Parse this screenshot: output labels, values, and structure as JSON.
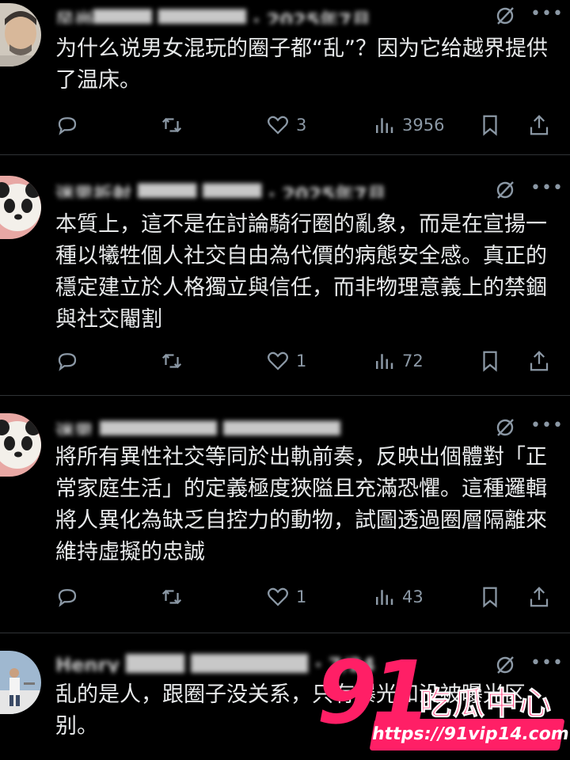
{
  "posts": [
    {
      "author_blurred": "风尚████ ██████ · 2025年7月",
      "text": "为什么说男女混玩的圈子都“乱”？因为它给越界提供了温床。",
      "reply_count": "",
      "repost_count": "",
      "like_count": "3",
      "view_count": "3956",
      "avatar": "man-portrait-avatar"
    },
    {
      "author_blurred": "迷思折射 ████ ████ · 2025年7月",
      "text": "本質上，這不是在討論騎行圈的亂象，而是在宣揚一種以犧牲個人社交自由為代價的病態安全感。真正的穩定建立於人格獨立與信任，而非物理意義上的禁錮與社交閹割",
      "reply_count": "",
      "repost_count": "",
      "like_count": "1",
      "view_count": "72",
      "avatar": "panda-avatar"
    },
    {
      "author_blurred": "迷思 ████████ ████████",
      "text": "將所有異性社交等同於出軌前奏，反映出個體對「正常家庭生活」的定義極度狹隘且充滿恐懼。這種邏輯將人異化為缺乏自控力的動物，試圖透過圈層隔離來維持虛擬的忠誠",
      "reply_count": "",
      "repost_count": "",
      "like_count": "1",
      "view_count": "43",
      "avatar": "panda-avatar"
    },
    {
      "author_blurred": "Henry ████ ████████ · 7/24",
      "text": "乱的是人，跟圈子没关系，只有曝光和没被曝光区别。",
      "avatar": "person-boat-avatar"
    }
  ],
  "watermark": {
    "number": "91",
    "brand": "吃瓜中心",
    "url": "https://91vip14.com"
  },
  "colors": {
    "background": "#000000",
    "text": "#e7e9ea",
    "muted": "#8b98a5",
    "divider": "#2f3336",
    "watermark": "#ff1f66"
  }
}
